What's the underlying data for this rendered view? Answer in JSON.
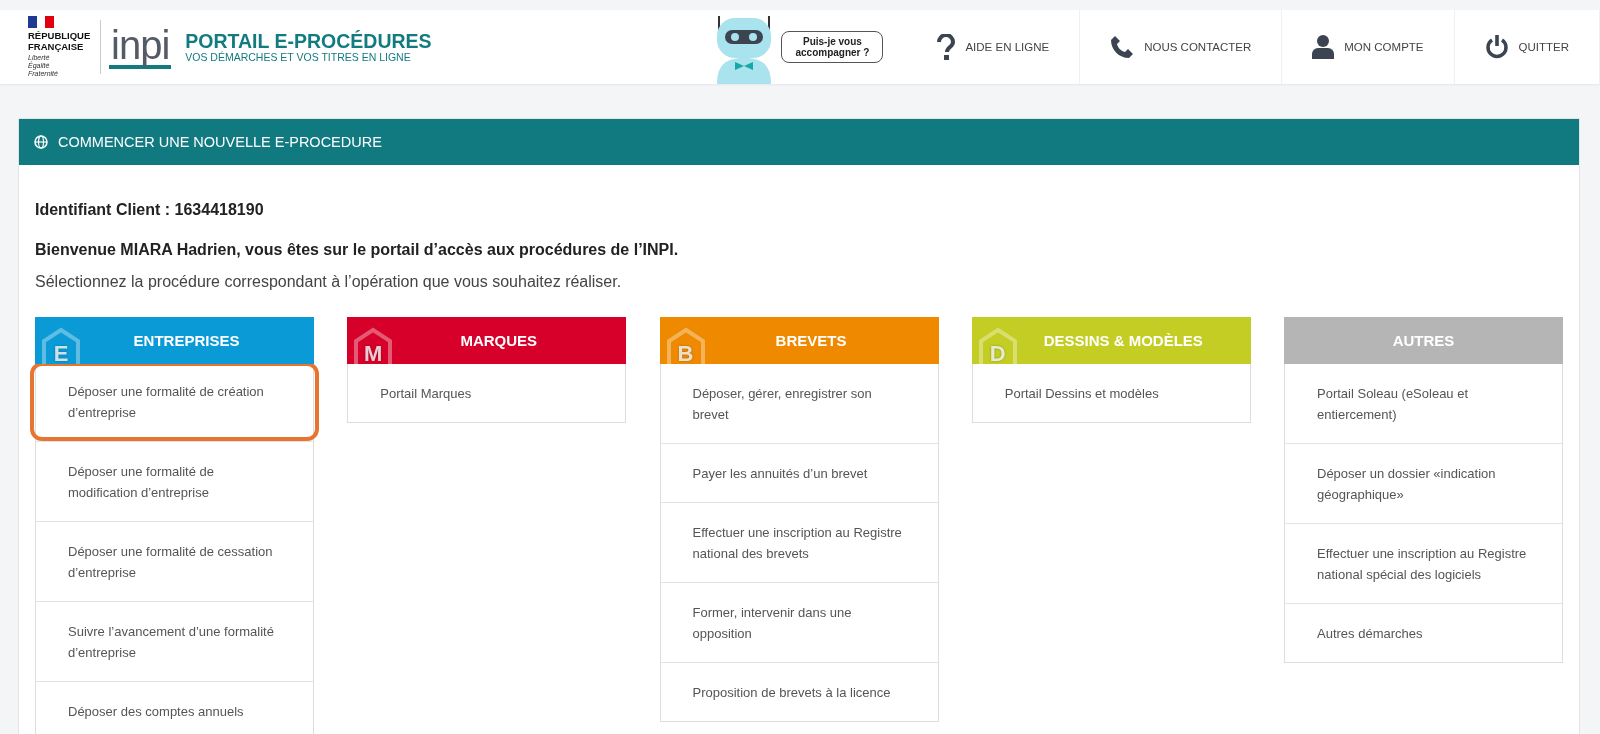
{
  "header": {
    "republic": {
      "name": "RÉPUBLIQUE FRANÇAISE",
      "motto": "Liberté Égalité Fraternité"
    },
    "logo": "inpi",
    "portal_title": "PORTAIL E-PROCÉDURES",
    "portal_subtitle": "VOS DÉMARCHES ET VOS TITRES EN LIGNE",
    "assistant_bubble": "Puis-je vous accompagner ?",
    "nav": [
      {
        "kind": "help",
        "label": "AIDE EN LIGNE"
      },
      {
        "kind": "phone",
        "label": "NOUS CONTACTER"
      },
      {
        "kind": "account",
        "label": "MON COMPTE"
      },
      {
        "kind": "power",
        "label": "QUITTER"
      }
    ]
  },
  "panel": {
    "title": "COMMENCER UNE NOUVELLE E-PROCEDURE",
    "client_id": "Identifiant Client : 1634418190",
    "welcome": "Bienvenue MIARA Hadrien, vous êtes sur le portail d’accès aux procédures de l’INPI.",
    "instruction": "Sélectionnez la procédure correspondant à l’opération que vous souhaitez réaliser.",
    "columns": [
      {
        "title": "ENTREPRISES",
        "letter": "E",
        "color": "#0a9ad6",
        "items": [
          {
            "label": "Déposer une formalité de création d’entreprise",
            "highlighted": true
          },
          {
            "label": "Déposer une formalité de modification d’entreprise",
            "highlighted": false
          },
          {
            "label": "Déposer une formalité de cessation d’entreprise",
            "highlighted": false
          },
          {
            "label": "Suivre l’avancement d’une formalité d’entreprise",
            "highlighted": false
          },
          {
            "label": "Déposer des comptes annuels",
            "highlighted": false
          }
        ]
      },
      {
        "title": "MARQUES",
        "letter": "M",
        "color": "#d6002a",
        "items": [
          {
            "label": "Portail Marques",
            "highlighted": false
          }
        ]
      },
      {
        "title": "BREVETS",
        "letter": "B",
        "color": "#ef8a00",
        "items": [
          {
            "label": "Déposer, gérer, enregistrer son brevet",
            "highlighted": false
          },
          {
            "label": "Payer les annuités d’un brevet",
            "highlighted": false
          },
          {
            "label": "Effectuer une inscription au Registre national des brevets",
            "highlighted": false
          },
          {
            "label": "Former, intervenir dans une opposition",
            "highlighted": false
          },
          {
            "label": "Proposition de brevets à la licence",
            "highlighted": false
          }
        ]
      },
      {
        "title": "DESSINS & MODÈLES",
        "letter": "D",
        "color": "#c3cd23",
        "items": [
          {
            "label": "Portail Dessins et modèles",
            "highlighted": false
          }
        ]
      },
      {
        "title": "AUTRES",
        "color": "#b6b5b6",
        "items": [
          {
            "label": "Portail Soleau (eSoleau et entiercement)",
            "highlighted": false
          },
          {
            "label": "Déposer un dossier «indication géographique»",
            "highlighted": false
          },
          {
            "label": "Effectuer une inscription au Registre national spécial des logiciels",
            "highlighted": false
          },
          {
            "label": "Autres démarches",
            "highlighted": false
          }
        ]
      }
    ]
  }
}
